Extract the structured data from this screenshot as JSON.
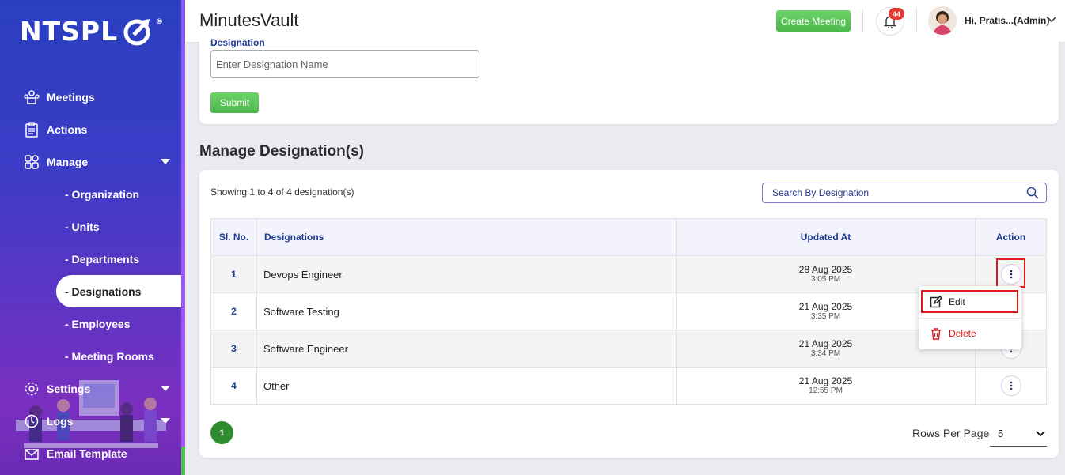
{
  "sidebar": {
    "logo": "NTSPL",
    "items": [
      {
        "label": "Meetings",
        "icon": "meetings-icon"
      },
      {
        "label": "Actions",
        "icon": "clipboard-icon"
      },
      {
        "label": "Manage",
        "icon": "grid-icon"
      },
      {
        "label": "Settings",
        "icon": "gear-icon"
      },
      {
        "label": "Logs",
        "icon": "history-icon"
      },
      {
        "label": "Email Template",
        "icon": "envelope-icon"
      }
    ],
    "sub_items": [
      "- Organization",
      "- Units",
      "- Departments",
      "- Designations",
      "- Employees",
      "- Meeting Rooms"
    ]
  },
  "header": {
    "title": "MinutesVault",
    "create_label": "Create Meeting",
    "notification_count": "44",
    "user_label": "Hi, Pratis...(Admin)"
  },
  "form": {
    "label": "Designation",
    "placeholder": "Enter Designation Name",
    "submit_label": "Submit"
  },
  "section_title": "Manage Designation(s)",
  "list": {
    "showing": "Showing 1 to 4 of 4 designation(s)",
    "search_placeholder": "Search By Designation",
    "columns": [
      "Sl. No.",
      "Designations",
      "Updated At",
      "Action"
    ],
    "rows": [
      {
        "sl": "1",
        "name": "Devops Engineer",
        "date": "28 Aug 2025",
        "time": "3:05 PM"
      },
      {
        "sl": "2",
        "name": "Software Testing",
        "date": "21 Aug 2025",
        "time": "3:35 PM"
      },
      {
        "sl": "3",
        "name": "Software Engineer",
        "date": "21 Aug 2025",
        "time": "3:34 PM"
      },
      {
        "sl": "4",
        "name": "Other",
        "date": "21 Aug 2025",
        "time": "12:55 PM"
      }
    ]
  },
  "menu": {
    "edit_label": "Edit",
    "delete_label": "Delete"
  },
  "pagination": {
    "page": "1",
    "rows_label": "Rows Per Page",
    "rows_value": "5"
  },
  "colors": {
    "brand_blue": "#1f3a93",
    "green": "#4cb84a",
    "highlight": "#e01b1b"
  }
}
